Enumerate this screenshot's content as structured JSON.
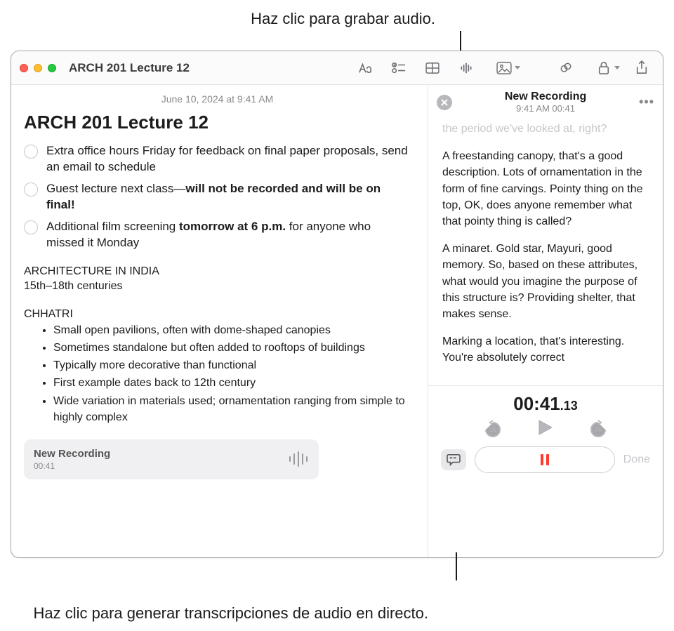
{
  "callouts": {
    "top": "Haz clic para grabar audio.",
    "bottom": "Haz clic para generar transcripciones de audio en directo."
  },
  "window": {
    "title": "ARCH 201 Lecture 12"
  },
  "note": {
    "date": "June 10, 2024 at 9:41 AM",
    "title": "ARCH 201 Lecture 12",
    "checklist": [
      {
        "pre": "Extra office hours Friday for feedback on final paper proposals, send an email to schedule",
        "bold": "",
        "post": ""
      },
      {
        "pre": "Guest lecture next class—",
        "bold": "will not be recorded and will be on final!",
        "post": ""
      },
      {
        "pre": "Additional film screening ",
        "bold": "tomorrow at 6 p.m.",
        "post": " for anyone who missed it Monday"
      }
    ],
    "section_title": "ARCHITECTURE IN INDIA",
    "section_sub": "15th–18th centuries",
    "chhatri_label": "CHHATRI",
    "bullets": [
      "Small open pavilions, often with dome-shaped canopies",
      "Sometimes standalone but often added to rooftops of buildings",
      "Typically more decorative than functional",
      "First example dates back to 12th century",
      "Wide variation in materials used; ornamentation ranging from simple to highly complex"
    ],
    "recording_chip": {
      "name": "New Recording",
      "duration": "00:41"
    }
  },
  "recording": {
    "title": "New Recording",
    "subtitle": "9:41 AM 00:41",
    "transcript_faded": "the period we've looked at, right?",
    "transcript": [
      "A freestanding canopy, that's a good description. Lots of ornamentation in the form of fine carvings. Pointy thing on the top, OK, does anyone remember what that pointy thing is called?",
      "A minaret. Gold star, Mayuri, good memory. So, based on these attributes, what would you imagine the purpose of this structure is? Providing shelter, that makes sense.",
      "Marking a location, that's interesting. You're absolutely correct"
    ],
    "timer_main": "00:41",
    "timer_frac": ".13",
    "skip_back_label": "15",
    "skip_fwd_label": "30",
    "done_label": "Done"
  }
}
